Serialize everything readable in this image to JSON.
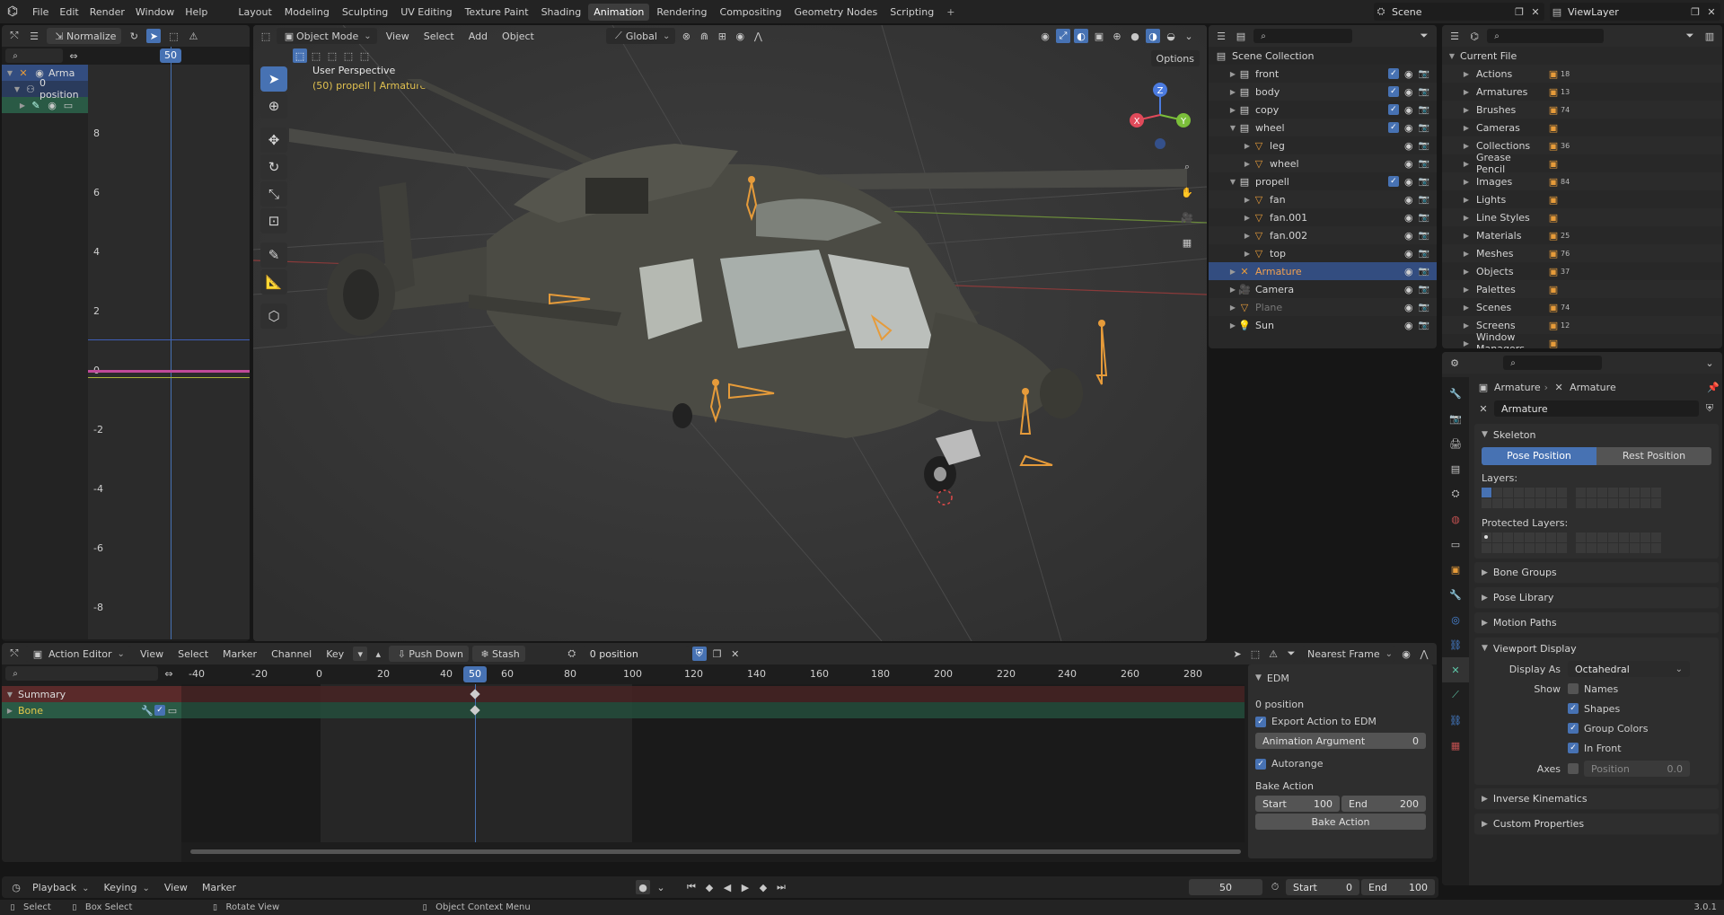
{
  "topbar": {
    "menus": [
      "File",
      "Edit",
      "Render",
      "Window",
      "Help"
    ],
    "workspaces": [
      "Layout",
      "Modeling",
      "Sculpting",
      "UV Editing",
      "Texture Paint",
      "Shading",
      "Animation",
      "Rendering",
      "Compositing",
      "Geometry Nodes",
      "Scripting"
    ],
    "active_workspace": "Animation",
    "add_tab": "+",
    "scene_label": "Scene",
    "viewlayer_label": "ViewLayer"
  },
  "dopesheet_small": {
    "normalize_label": "Normalize",
    "frame_indicator": "50",
    "channels": [
      {
        "label": "Arma"
      },
      {
        "label": "0 position"
      },
      {
        "label": ""
      }
    ],
    "y_ticks": [
      "8",
      "6",
      "4",
      "2",
      "0",
      "-2",
      "-4",
      "-6",
      "-8"
    ]
  },
  "viewport": {
    "mode": "Object Mode",
    "menus": [
      "View",
      "Select",
      "Add",
      "Object"
    ],
    "transform_orientation": "Global",
    "options_label": "Options",
    "overlay_title": "User Perspective",
    "overlay_subtitle": "(50) propell | Armature",
    "gizmo": {
      "x": "X",
      "y": "Y",
      "z": "Z"
    }
  },
  "outliner": {
    "scene_collection": "Scene Collection",
    "items": [
      {
        "name": "front",
        "indent": 1,
        "type": "collection",
        "checked": true,
        "expanded": false
      },
      {
        "name": "body",
        "indent": 1,
        "type": "collection",
        "checked": true,
        "expanded": false
      },
      {
        "name": "copy",
        "indent": 1,
        "type": "collection",
        "checked": true,
        "expanded": false
      },
      {
        "name": "wheel",
        "indent": 1,
        "type": "collection",
        "checked": true,
        "expanded": true
      },
      {
        "name": "leg",
        "indent": 2,
        "type": "mesh",
        "checked": false,
        "expanded": false
      },
      {
        "name": "wheel",
        "indent": 2,
        "type": "mesh",
        "checked": false,
        "expanded": false
      },
      {
        "name": "propell",
        "indent": 1,
        "type": "collection",
        "checked": true,
        "expanded": true
      },
      {
        "name": "fan",
        "indent": 2,
        "type": "mesh",
        "checked": false,
        "expanded": false
      },
      {
        "name": "fan.001",
        "indent": 2,
        "type": "mesh",
        "checked": false,
        "expanded": false
      },
      {
        "name": "fan.002",
        "indent": 2,
        "type": "mesh",
        "checked": false,
        "expanded": false
      },
      {
        "name": "top",
        "indent": 2,
        "type": "mesh",
        "checked": false,
        "expanded": false
      },
      {
        "name": "Armature",
        "indent": 1,
        "type": "armature",
        "checked": false,
        "expanded": false,
        "selected": true
      },
      {
        "name": "Camera",
        "indent": 1,
        "type": "camera",
        "checked": false,
        "expanded": false
      },
      {
        "name": "Plane",
        "indent": 1,
        "type": "mesh",
        "checked": false,
        "expanded": false,
        "dim": true
      },
      {
        "name": "Sun",
        "indent": 1,
        "type": "light",
        "checked": false,
        "expanded": false
      }
    ]
  },
  "datablocks": {
    "root": "Current File",
    "items": [
      {
        "name": "Actions",
        "count": "18"
      },
      {
        "name": "Armatures",
        "count": "13"
      },
      {
        "name": "Brushes",
        "count": "74"
      },
      {
        "name": "Cameras",
        "count": ""
      },
      {
        "name": "Collections",
        "count": "36"
      },
      {
        "name": "Grease Pencil",
        "count": ""
      },
      {
        "name": "Images",
        "count": "84"
      },
      {
        "name": "Lights",
        "count": ""
      },
      {
        "name": "Line Styles",
        "count": ""
      },
      {
        "name": "Materials",
        "count": "25"
      },
      {
        "name": "Meshes",
        "count": "76"
      },
      {
        "name": "Objects",
        "count": "37"
      },
      {
        "name": "Palettes",
        "count": ""
      },
      {
        "name": "Scenes",
        "count": "74"
      },
      {
        "name": "Screens",
        "count": "12"
      },
      {
        "name": "Window Managers",
        "count": ""
      }
    ]
  },
  "properties": {
    "breadcrumb_obj": "Armature",
    "breadcrumb_data": "Armature",
    "data_name": "Armature",
    "skeleton_label": "Skeleton",
    "pose_position": "Pose Position",
    "rest_position": "Rest Position",
    "layers_label": "Layers:",
    "protected_layers_label": "Protected Layers:",
    "sections": [
      "Bone Groups",
      "Pose Library",
      "Motion Paths"
    ],
    "viewport_display": "Viewport Display",
    "display_as_label": "Display As",
    "display_as_value": "Octahedral",
    "show_label": "Show",
    "show_items": [
      {
        "label": "Names",
        "checked": false
      },
      {
        "label": "Shapes",
        "checked": true
      },
      {
        "label": "Group Colors",
        "checked": true
      },
      {
        "label": "In Front",
        "checked": true
      }
    ],
    "axes_label": "Axes",
    "position_label": "Position",
    "position_value": "0.0",
    "bottom_sections": [
      "Inverse Kinematics",
      "Custom Properties"
    ]
  },
  "action_editor": {
    "mode": "Action Editor",
    "menus": [
      "View",
      "Select",
      "Marker",
      "Channel",
      "Key"
    ],
    "push_down": "Push Down",
    "stash": "Stash",
    "action_name": "0 position",
    "snap_mode": "Nearest Frame",
    "frame_ticks": [
      "-40",
      "-20",
      "0",
      "20",
      "40",
      "50",
      "60",
      "80",
      "100",
      "120",
      "140",
      "160",
      "180",
      "200",
      "220",
      "240",
      "260",
      "280"
    ],
    "current_frame": "50",
    "channels": [
      {
        "label": "Summary"
      },
      {
        "label": "Bone"
      }
    ]
  },
  "edm_panel": {
    "title": "EDM",
    "action": "0 position",
    "export_label": "Export Action to EDM",
    "anim_arg_label": "Animation Argument",
    "anim_arg_value": "0",
    "autorange_label": "Autorange",
    "bake_label": "Bake Action",
    "start_label": "Start",
    "start_value": "100",
    "end_label": "End",
    "end_value": "200",
    "bake_button": "Bake Action"
  },
  "timeline": {
    "menus": [
      "Playback",
      "Keying",
      "View",
      "Marker"
    ],
    "current_frame": "50",
    "start_label": "Start",
    "start_value": "0",
    "end_label": "End",
    "end_value": "100"
  },
  "statusbar": {
    "select": "Select",
    "box_select": "Box Select",
    "rotate_view": "Rotate View",
    "context_menu": "Object Context Menu",
    "version": "3.0.1"
  },
  "colors": {
    "accent": "#4772b3",
    "selected_row": "#334d80",
    "armature_orange": "#e69b3a",
    "summary_row": "#5a2a2a",
    "bone_row": "#2a5a45"
  }
}
